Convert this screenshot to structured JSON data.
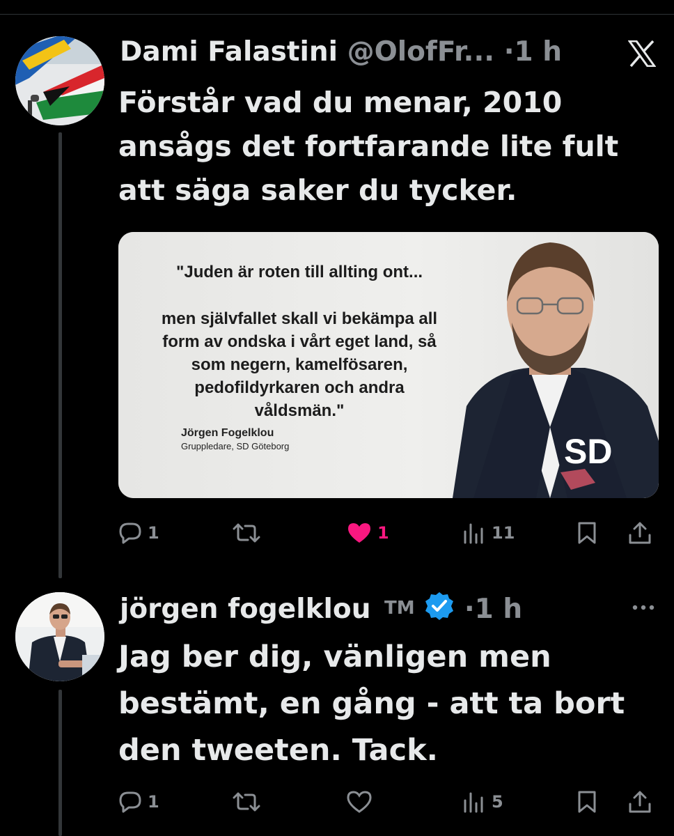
{
  "tweets": [
    {
      "author": "Dami Falastini",
      "handle": "@OlofFr...",
      "time": "·1 h",
      "text": [
        "Förstår vad du menar, 2010",
        "ansågs det fortfarande lite fult",
        "att säga saker du tycker."
      ],
      "media": {
        "quote_line1": "\"Juden är roten till allting ont...",
        "quote_lines": [
          "men självfallet skall vi bekämpa all",
          "form av ondska i vårt eget land, så",
          "som negern, kamelfösaren,",
          "pedofildyrkaren och andra",
          "våldsmän.\""
        ],
        "attribution_name": "Jörgen Fogelklou",
        "attribution_title": "Gruppledare, SD Göteborg",
        "logo_text": "SD"
      },
      "stats": {
        "replies": "1",
        "retweets": "",
        "likes": "1",
        "views": "11"
      },
      "liked": true
    },
    {
      "author": "jörgen fogelklou",
      "suffix": "TM",
      "time": "·1 h",
      "text": [
        "Jag ber dig, vänligen men",
        "bestämt, en gång - att ta bort",
        "den tweeten. Tack."
      ],
      "stats": {
        "replies": "1",
        "retweets": "",
        "likes": "",
        "views": "5"
      },
      "liked": false
    }
  ],
  "colors": {
    "like": "#f91880",
    "verified": "#1d9bf0",
    "muted": "#8b8f94",
    "background": "#000000"
  },
  "icons": [
    "x-logo-icon",
    "more-icon",
    "verified-badge-icon",
    "reply-icon",
    "retweet-icon",
    "like-icon",
    "views-icon",
    "bookmark-icon",
    "share-icon"
  ]
}
